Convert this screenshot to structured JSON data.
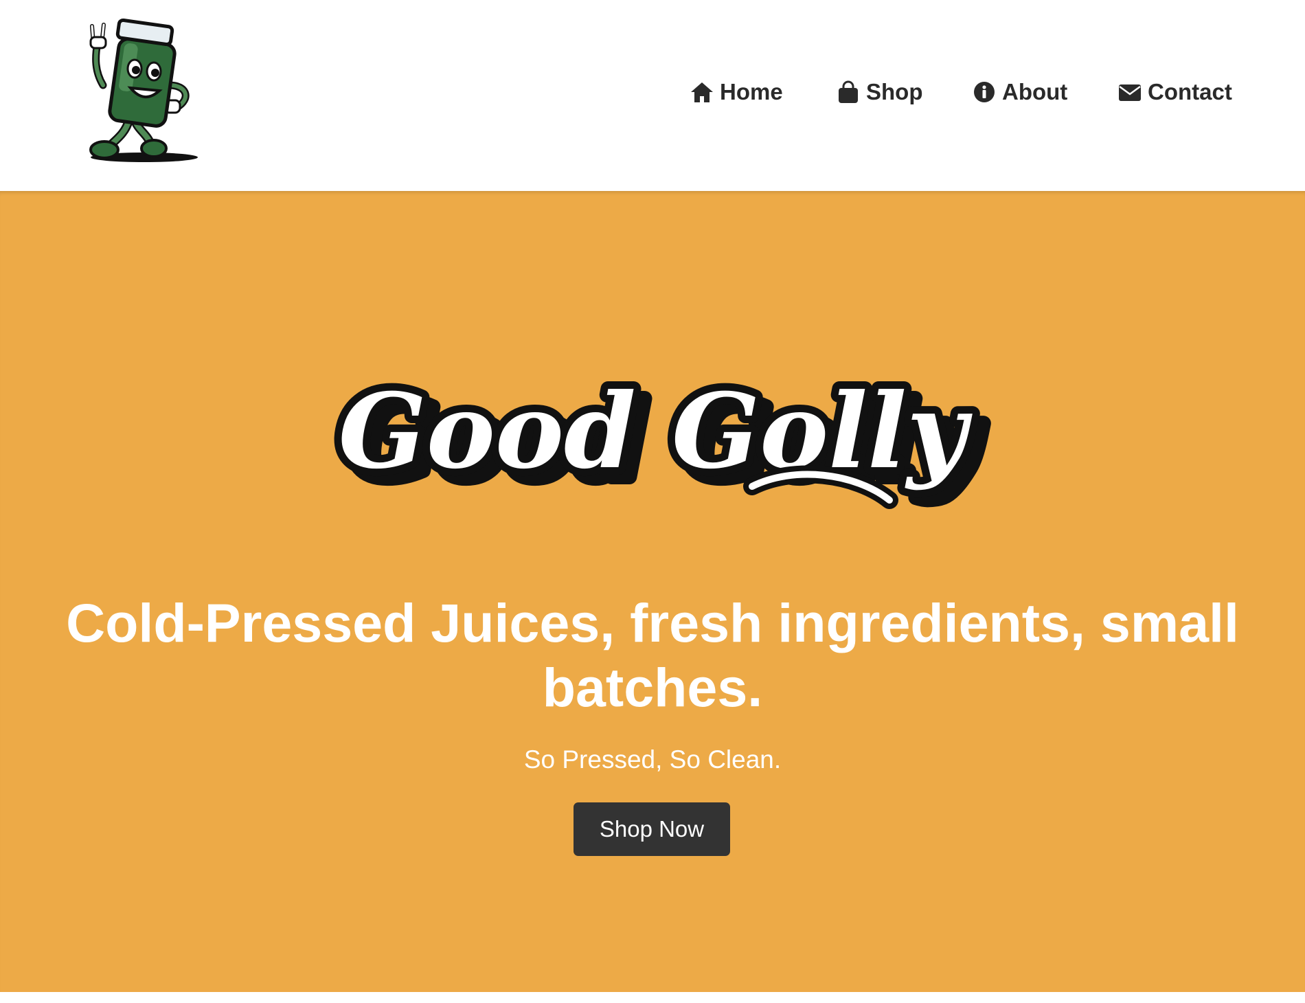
{
  "brand": {
    "logo_icon": "juice-jar-mascot-icon",
    "wordmark": "Good Golly",
    "colors": {
      "hero_bg": "#edaa47",
      "button_bg": "#333333",
      "nav_text": "#2a2a2a",
      "mascot_green": "#2f6b3a"
    }
  },
  "nav": {
    "items": [
      {
        "label": "Home",
        "icon": "home-icon"
      },
      {
        "label": "Shop",
        "icon": "shopping-bag-icon"
      },
      {
        "label": "About",
        "icon": "info-circle-icon"
      },
      {
        "label": "Contact",
        "icon": "envelope-icon"
      }
    ]
  },
  "hero": {
    "title": "Cold-Pressed Juices, fresh ingredients, small batches.",
    "subtitle": "So Pressed, So Clean.",
    "cta_label": "Shop Now"
  }
}
